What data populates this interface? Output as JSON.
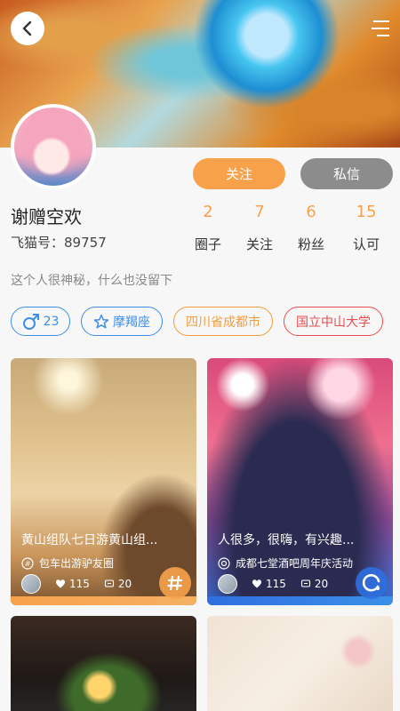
{
  "header": {
    "back_icon": "chevron-left-icon",
    "menu_icon": "menu-icon"
  },
  "actions": {
    "follow_label": "关注",
    "message_label": "私信"
  },
  "profile": {
    "name": "谢赠空欢",
    "id_label": "飞猫号：",
    "id_value": "89757",
    "bio": "这个人很神秘，什么也没留下"
  },
  "stats": [
    {
      "value": "2",
      "label": "圈子"
    },
    {
      "value": "7",
      "label": "关注"
    },
    {
      "value": "6",
      "label": "粉丝"
    },
    {
      "value": "15",
      "label": "认可"
    }
  ],
  "tags": {
    "gender_age": "23",
    "constellation": "摩羯座",
    "location": "四川省成都市",
    "school": "国立中山大学"
  },
  "posts": [
    {
      "title": "黄山组队七日游黄山组...",
      "circle": "包车出游驴友圈",
      "likes": "115",
      "comments": "20",
      "corner_icon": "hash-icon"
    },
    {
      "title": "人很多，很嗨，有兴趣...",
      "circle": "成都七堂酒吧周年庆活动",
      "likes": "115",
      "comments": "20",
      "corner_icon": "loading-ring-icon"
    }
  ],
  "colors": {
    "accent": "#f7a24b",
    "grey_button": "#8c8c8c",
    "blue": "#3b8fe8",
    "red": "#ea4d4d"
  }
}
